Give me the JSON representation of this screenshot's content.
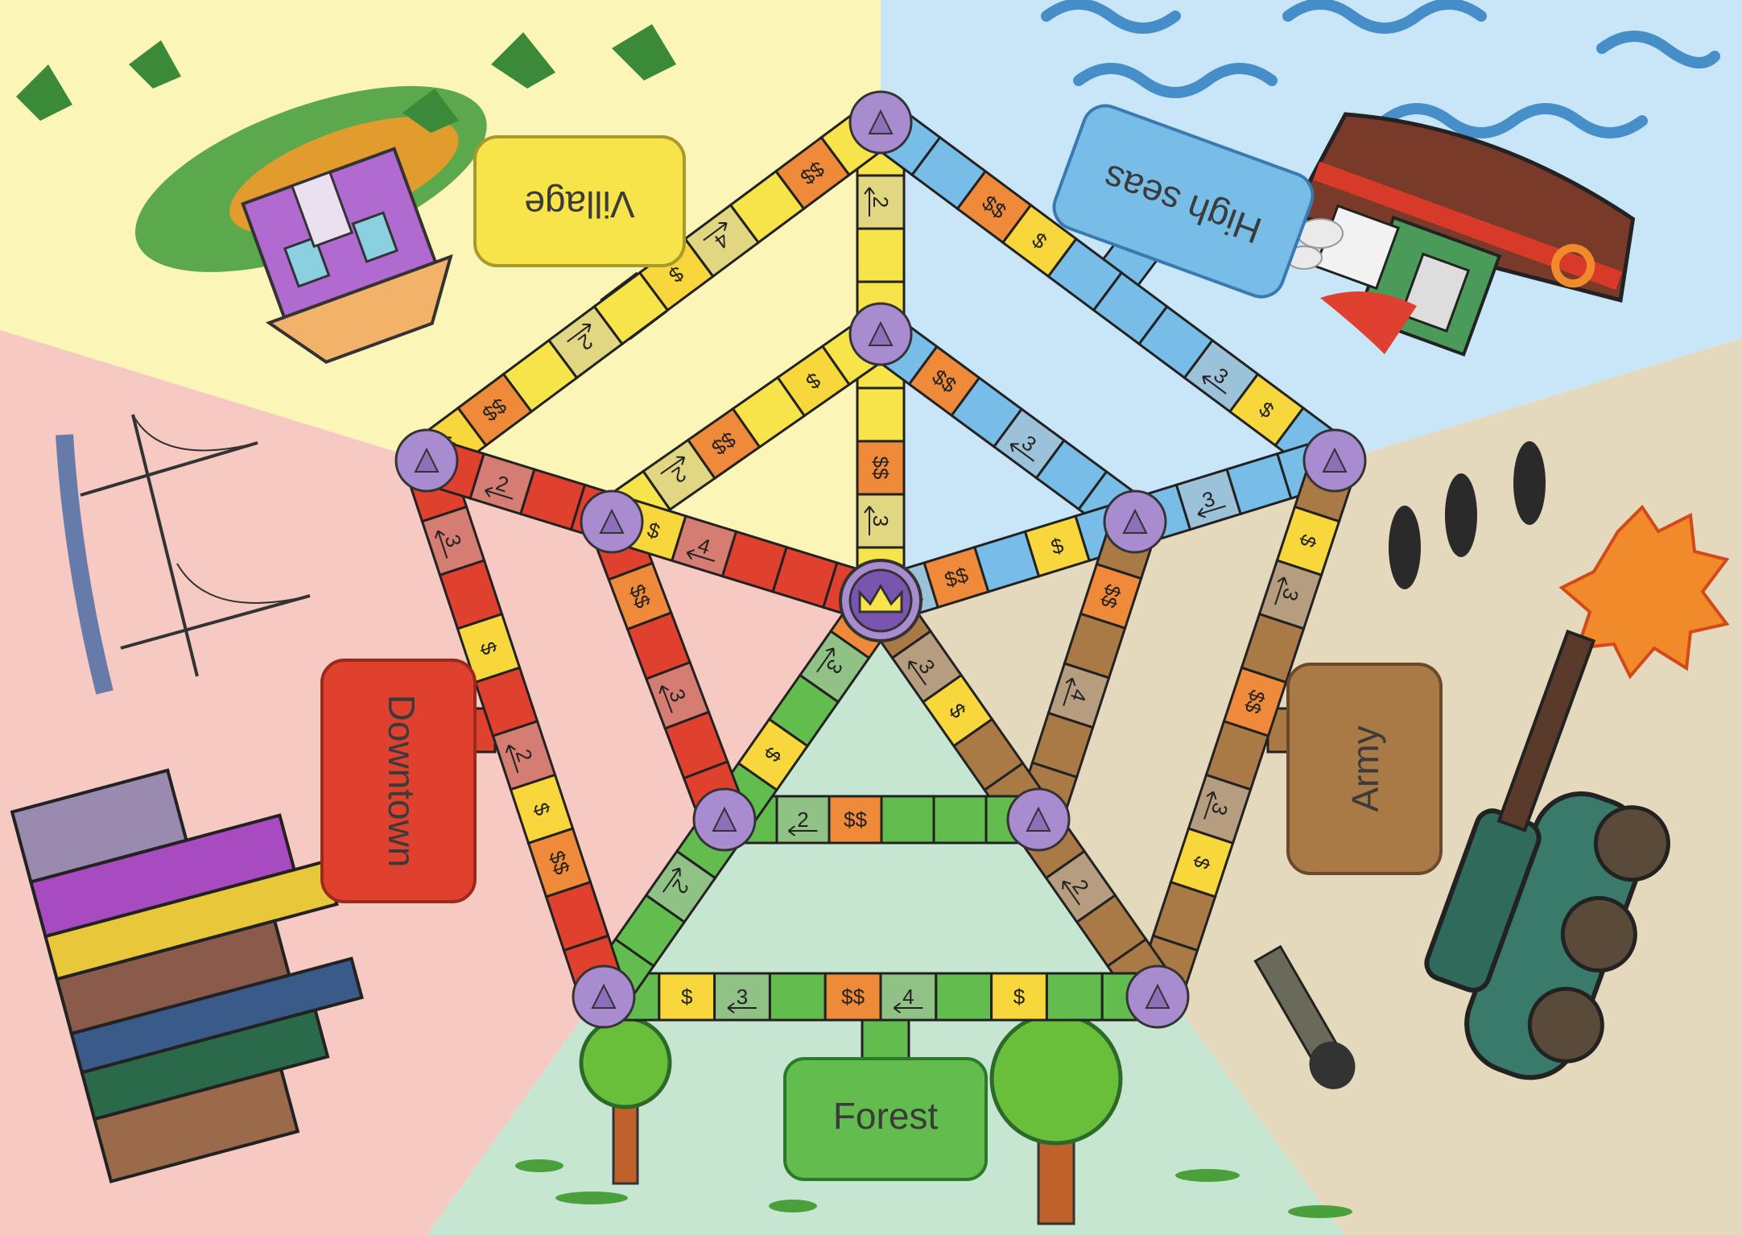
{
  "zones": [
    {
      "id": "village",
      "label": "Village",
      "color": "#fbf5b8"
    },
    {
      "id": "highseas",
      "label": "High seas",
      "color": "#c9e6f8"
    },
    {
      "id": "army",
      "label": "Army",
      "color": "#e4d9bd"
    },
    {
      "id": "forest",
      "label": "Forest",
      "color": "#c7e6d2"
    },
    {
      "id": "downtown",
      "label": "Downtown",
      "color": "#f6c9c2"
    }
  ],
  "path_colors": {
    "yellow": "#f6e44a",
    "blue": "#78bde8",
    "brown": "#a97a45",
    "green": "#63bd4e",
    "red": "#e0402e",
    "money": "#f7d73b",
    "bigmoney": "#ee8a3a",
    "corner": "#a98bd0",
    "corner_inner": "#8d6fba"
  },
  "tiles": {
    "money": "$",
    "bigmoney": "$$",
    "move_labels": [
      "2",
      "3",
      "4"
    ]
  },
  "center_icon": "crown-icon",
  "corner_icon": "triangle-icon"
}
